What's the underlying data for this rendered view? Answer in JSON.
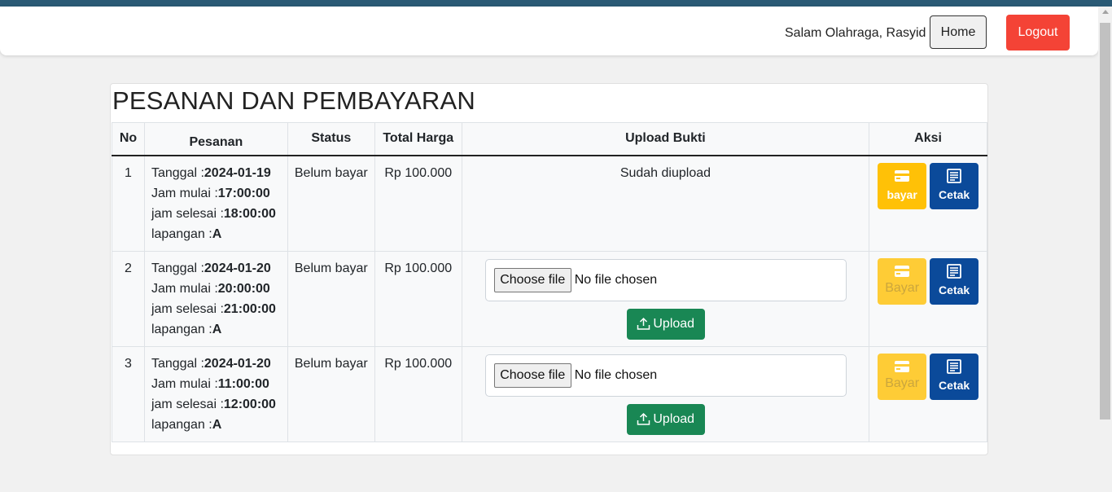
{
  "navbar": {
    "greeting": "Salam Olahraga, Rasyid",
    "home_label": "Home",
    "logout_label": "Logout"
  },
  "page": {
    "title": "PESANAN DAN PEMBAYARAN"
  },
  "table": {
    "headers": [
      "No",
      "Pesanan",
      "Status",
      "Total Harga",
      "Upload Bukti",
      "Aksi"
    ],
    "pesanan_labels": {
      "tanggal": "Tanggal :",
      "jam_mulai": "Jam mulai :",
      "jam_selesai": "jam selesai :",
      "lapangan": "lapangan :"
    },
    "rows": [
      {
        "no": "1",
        "tanggal": "2024-01-19",
        "jam_mulai": "17:00:00",
        "jam_selesai": "18:00:00",
        "lapangan": "A",
        "status": "Belum bayar",
        "total": "Rp 100.000",
        "upload_status": "Sudah diupload",
        "bayar_label": "bayar",
        "bayar_enabled": true,
        "cetak_label": "Cetak"
      },
      {
        "no": "2",
        "tanggal": "2024-01-20",
        "jam_mulai": "20:00:00",
        "jam_selesai": "21:00:00",
        "lapangan": "A",
        "status": "Belum bayar",
        "total": "Rp 100.000",
        "choose_file_label": "Choose file",
        "no_file_label": "No file chosen",
        "upload_label": "Upload",
        "bayar_label": "Bayar",
        "bayar_enabled": false,
        "cetak_label": "Cetak"
      },
      {
        "no": "3",
        "tanggal": "2024-01-20",
        "jam_mulai": "11:00:00",
        "jam_selesai": "12:00:00",
        "lapangan": "A",
        "status": "Belum bayar",
        "total": "Rp 100.000",
        "choose_file_label": "Choose file",
        "no_file_label": "No file chosen",
        "upload_label": "Upload",
        "bayar_label": "Bayar",
        "bayar_enabled": false,
        "cetak_label": "Cetak"
      }
    ]
  },
  "icons": {
    "bayar": "credit-card-icon",
    "cetak": "receipt-icon",
    "upload": "upload-icon"
  },
  "colors": {
    "topstrip": "#2a5a75",
    "logout": "#f44336",
    "upload": "#198754",
    "bayar": "#ffc107",
    "cetak": "#0b4a9a"
  }
}
